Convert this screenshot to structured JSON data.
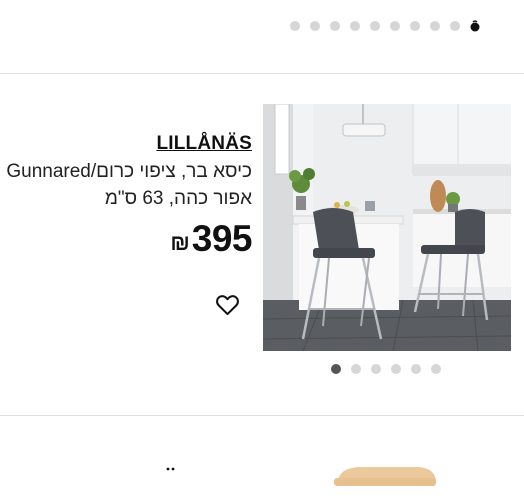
{
  "top_carousel": {
    "dot_count": 10,
    "active_index": 9
  },
  "product": {
    "name": "LILLÅNÄS",
    "description": "כיסא בר, ציפוי כרום/Gunnared אפור כהה, 63 ס\"מ",
    "price": {
      "currency": "₪",
      "value": "395"
    },
    "image_dots": {
      "count": 6,
      "active_index": 0
    },
    "favorite": false
  },
  "icons": [
    "heart-icon",
    "carousel-dot-icon"
  ],
  "colors": {
    "text": "#111111",
    "divider": "#dfdfdf",
    "dot_inactive": "#d6d6d6",
    "dot_active": "#555555"
  }
}
